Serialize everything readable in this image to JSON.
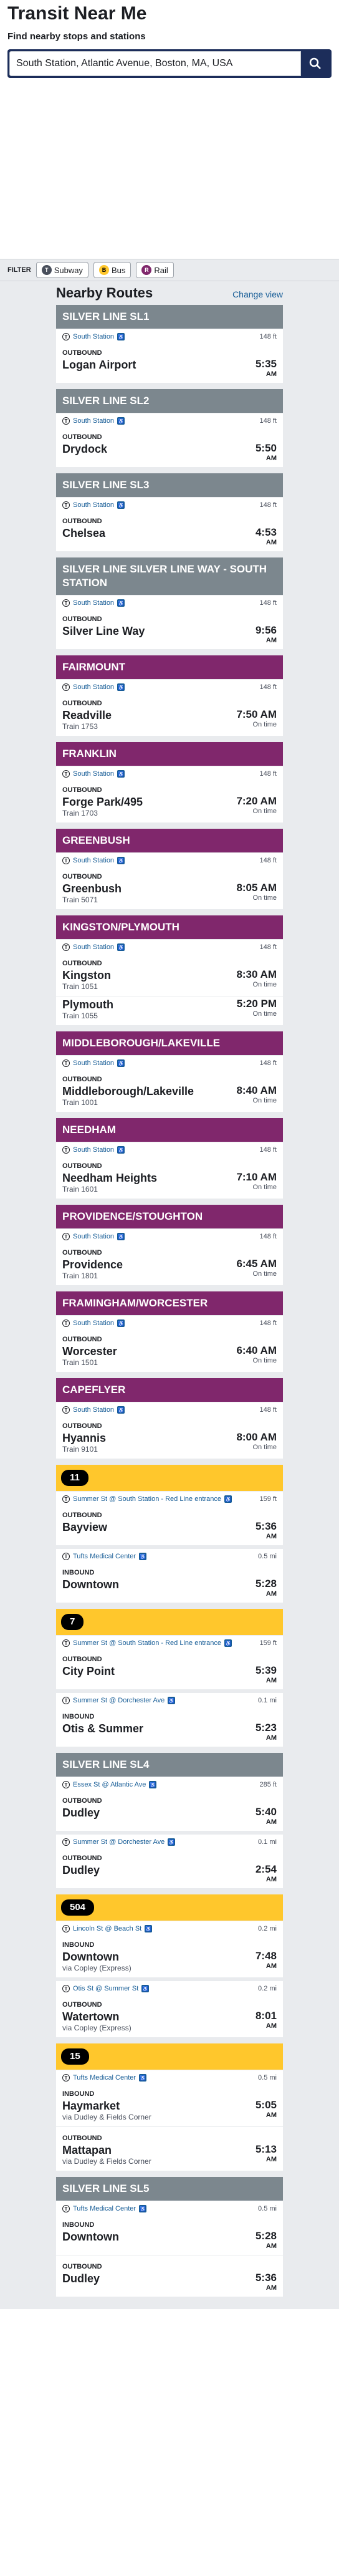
{
  "app": {
    "title": "Transit Near Me",
    "subtitle": "Find nearby stops and stations",
    "search_value": "South Station, Atlantic Avenue, Boston, MA, USA"
  },
  "filter": {
    "label": "FILTER",
    "buttons": [
      {
        "label": "Subway",
        "icon": "subway-icon",
        "color": "#494f5c"
      },
      {
        "label": "Bus",
        "icon": "bus-icon",
        "color": "#ffc72c"
      },
      {
        "label": "Rail",
        "icon": "rail-icon",
        "color": "#80276c"
      }
    ]
  },
  "routes_header": {
    "title": "Nearby Routes",
    "change_view": "Change view"
  },
  "colors": {
    "silver": "#7c878e",
    "commuter_rail": "#80276c",
    "bus": "#ffc72c",
    "link": "#165c96"
  },
  "routes": [
    {
      "name": "SILVER LINE SL1",
      "type": "silver",
      "sections": [
        {
          "stop": "South Station",
          "dist": "148 ft",
          "directions": [
            {
              "dir": "OUTBOUND",
              "trips": [
                {
                  "headsign": "Logan Airport",
                  "sub": "",
                  "time": "5:35",
                  "ampm": "AM",
                  "status": ""
                }
              ]
            }
          ]
        }
      ]
    },
    {
      "name": "SILVER LINE SL2",
      "type": "silver",
      "sections": [
        {
          "stop": "South Station",
          "dist": "148 ft",
          "directions": [
            {
              "dir": "OUTBOUND",
              "trips": [
                {
                  "headsign": "Drydock",
                  "sub": "",
                  "time": "5:50",
                  "ampm": "AM",
                  "status": ""
                }
              ]
            }
          ]
        }
      ]
    },
    {
      "name": "SILVER LINE SL3",
      "type": "silver",
      "sections": [
        {
          "stop": "South Station",
          "dist": "148 ft",
          "directions": [
            {
              "dir": "OUTBOUND",
              "trips": [
                {
                  "headsign": "Chelsea",
                  "sub": "",
                  "time": "4:53",
                  "ampm": "AM",
                  "status": ""
                }
              ]
            }
          ]
        }
      ]
    },
    {
      "name": "SILVER LINE SILVER LINE WAY - SOUTH STATION",
      "type": "silver",
      "sections": [
        {
          "stop": "South Station",
          "dist": "148 ft",
          "directions": [
            {
              "dir": "OUTBOUND",
              "trips": [
                {
                  "headsign": "Silver Line Way",
                  "sub": "",
                  "time": "9:56",
                  "ampm": "AM",
                  "status": ""
                }
              ]
            }
          ]
        }
      ]
    },
    {
      "name": "FAIRMOUNT",
      "type": "cr",
      "sections": [
        {
          "stop": "South Station",
          "dist": "148 ft",
          "directions": [
            {
              "dir": "OUTBOUND",
              "trips": [
                {
                  "headsign": "Readville",
                  "sub": "Train 1753",
                  "time": "7:50 AM",
                  "ampm": "",
                  "status": "On time"
                }
              ]
            }
          ]
        }
      ]
    },
    {
      "name": "FRANKLIN",
      "type": "cr",
      "sections": [
        {
          "stop": "South Station",
          "dist": "148 ft",
          "directions": [
            {
              "dir": "OUTBOUND",
              "trips": [
                {
                  "headsign": "Forge Park/495",
                  "sub": "Train 1703",
                  "time": "7:20 AM",
                  "ampm": "",
                  "status": "On time"
                }
              ]
            }
          ]
        }
      ]
    },
    {
      "name": "GREENBUSH",
      "type": "cr",
      "sections": [
        {
          "stop": "South Station",
          "dist": "148 ft",
          "directions": [
            {
              "dir": "OUTBOUND",
              "trips": [
                {
                  "headsign": "Greenbush",
                  "sub": "Train 5071",
                  "time": "8:05 AM",
                  "ampm": "",
                  "status": "On time"
                }
              ]
            }
          ]
        }
      ]
    },
    {
      "name": "KINGSTON/PLYMOUTH",
      "type": "cr",
      "sections": [
        {
          "stop": "South Station",
          "dist": "148 ft",
          "directions": [
            {
              "dir": "OUTBOUND",
              "trips": [
                {
                  "headsign": "Kingston",
                  "sub": "Train 1051",
                  "time": "8:30 AM",
                  "ampm": "",
                  "status": "On time"
                },
                {
                  "headsign": "Plymouth",
                  "sub": "Train 1055",
                  "time": "5:20 PM",
                  "ampm": "",
                  "status": "On time"
                }
              ]
            }
          ]
        }
      ]
    },
    {
      "name": "MIDDLEBOROUGH/LAKEVILLE",
      "type": "cr",
      "sections": [
        {
          "stop": "South Station",
          "dist": "148 ft",
          "directions": [
            {
              "dir": "OUTBOUND",
              "trips": [
                {
                  "headsign": "Middleborough/Lakeville",
                  "sub": "Train 1001",
                  "time": "8:40 AM",
                  "ampm": "",
                  "status": "On time"
                }
              ]
            }
          ]
        }
      ]
    },
    {
      "name": "NEEDHAM",
      "type": "cr",
      "sections": [
        {
          "stop": "South Station",
          "dist": "148 ft",
          "directions": [
            {
              "dir": "OUTBOUND",
              "trips": [
                {
                  "headsign": "Needham Heights",
                  "sub": "Train 1601",
                  "time": "7:10 AM",
                  "ampm": "",
                  "status": "On time"
                }
              ]
            }
          ]
        }
      ]
    },
    {
      "name": "PROVIDENCE/STOUGHTON",
      "type": "cr",
      "sections": [
        {
          "stop": "South Station",
          "dist": "148 ft",
          "directions": [
            {
              "dir": "OUTBOUND",
              "trips": [
                {
                  "headsign": "Providence",
                  "sub": "Train 1801",
                  "time": "6:45 AM",
                  "ampm": "",
                  "status": "On time"
                }
              ]
            }
          ]
        }
      ]
    },
    {
      "name": "FRAMINGHAM/WORCESTER",
      "type": "cr",
      "sections": [
        {
          "stop": "South Station",
          "dist": "148 ft",
          "directions": [
            {
              "dir": "OUTBOUND",
              "trips": [
                {
                  "headsign": "Worcester",
                  "sub": "Train 1501",
                  "time": "6:40 AM",
                  "ampm": "",
                  "status": "On time"
                }
              ]
            }
          ]
        }
      ]
    },
    {
      "name": "CAPEFLYER",
      "type": "cr",
      "sections": [
        {
          "stop": "South Station",
          "dist": "148 ft",
          "directions": [
            {
              "dir": "OUTBOUND",
              "trips": [
                {
                  "headsign": "Hyannis",
                  "sub": "Train 9101",
                  "time": "8:00 AM",
                  "ampm": "",
                  "status": "On time"
                }
              ]
            }
          ]
        }
      ]
    },
    {
      "name": "11",
      "type": "bus",
      "sections": [
        {
          "stop": "Summer St @ South Station - Red Line entrance",
          "dist": "159 ft",
          "directions": [
            {
              "dir": "OUTBOUND",
              "trips": [
                {
                  "headsign": "Bayview",
                  "sub": "",
                  "time": "5:36",
                  "ampm": "AM",
                  "status": ""
                }
              ]
            }
          ]
        },
        {
          "stop": "Tufts Medical Center",
          "dist": "0.5 mi",
          "directions": [
            {
              "dir": "INBOUND",
              "trips": [
                {
                  "headsign": "Downtown",
                  "sub": "",
                  "time": "5:28",
                  "ampm": "AM",
                  "status": ""
                }
              ]
            }
          ]
        }
      ]
    },
    {
      "name": "7",
      "type": "bus",
      "sections": [
        {
          "stop": "Summer St @ South Station - Red Line entrance",
          "dist": "159 ft",
          "directions": [
            {
              "dir": "OUTBOUND",
              "trips": [
                {
                  "headsign": "City Point",
                  "sub": "",
                  "time": "5:39",
                  "ampm": "AM",
                  "status": ""
                }
              ]
            }
          ]
        },
        {
          "stop": "Summer St @ Dorchester Ave",
          "dist": "0.1 mi",
          "directions": [
            {
              "dir": "INBOUND",
              "trips": [
                {
                  "headsign": "Otis & Summer",
                  "sub": "",
                  "time": "5:23",
                  "ampm": "AM",
                  "status": ""
                }
              ]
            }
          ]
        }
      ]
    },
    {
      "name": "SILVER LINE SL4",
      "type": "silver",
      "sections": [
        {
          "stop": "Essex St @ Atlantic Ave",
          "dist": "285 ft",
          "directions": [
            {
              "dir": "OUTBOUND",
              "trips": [
                {
                  "headsign": "Dudley",
                  "sub": "",
                  "time": "5:40",
                  "ampm": "AM",
                  "status": ""
                }
              ]
            }
          ]
        },
        {
          "stop": "Summer St @ Dorchester Ave",
          "dist": "0.1 mi",
          "directions": [
            {
              "dir": "OUTBOUND",
              "trips": [
                {
                  "headsign": "Dudley",
                  "sub": "",
                  "time": "2:54",
                  "ampm": "AM",
                  "status": ""
                }
              ]
            }
          ]
        }
      ]
    },
    {
      "name": "504",
      "type": "bus",
      "sections": [
        {
          "stop": "Lincoln St @ Beach St",
          "dist": "0.2 mi",
          "directions": [
            {
              "dir": "INBOUND",
              "trips": [
                {
                  "headsign": "Downtown",
                  "sub": "via Copley (Express)",
                  "time": "7:48",
                  "ampm": "AM",
                  "status": ""
                }
              ]
            }
          ]
        },
        {
          "stop": "Otis St @ Summer St",
          "dist": "0.2 mi",
          "directions": [
            {
              "dir": "OUTBOUND",
              "trips": [
                {
                  "headsign": "Watertown",
                  "sub": "via Copley (Express)",
                  "time": "8:01",
                  "ampm": "AM",
                  "status": ""
                }
              ]
            }
          ]
        }
      ]
    },
    {
      "name": "15",
      "type": "bus",
      "sections": [
        {
          "stop": "Tufts Medical Center",
          "dist": "0.5 mi",
          "directions": [
            {
              "dir": "INBOUND",
              "trips": [
                {
                  "headsign": "Haymarket",
                  "sub": "via Dudley & Fields Corner",
                  "time": "5:05",
                  "ampm": "AM",
                  "status": ""
                }
              ]
            },
            {
              "dir": "OUTBOUND",
              "trips": [
                {
                  "headsign": "Mattapan",
                  "sub": "via Dudley & Fields Corner",
                  "time": "5:13",
                  "ampm": "AM",
                  "status": ""
                }
              ]
            }
          ]
        }
      ]
    },
    {
      "name": "SILVER LINE SL5",
      "type": "silver",
      "sections": [
        {
          "stop": "Tufts Medical Center",
          "dist": "0.5 mi",
          "directions": [
            {
              "dir": "INBOUND",
              "trips": [
                {
                  "headsign": "Downtown",
                  "sub": "",
                  "time": "5:28",
                  "ampm": "AM",
                  "status": ""
                }
              ]
            },
            {
              "dir": "OUTBOUND",
              "trips": [
                {
                  "headsign": "Dudley",
                  "sub": "",
                  "time": "5:36",
                  "ampm": "AM",
                  "status": ""
                }
              ]
            }
          ]
        }
      ]
    }
  ]
}
